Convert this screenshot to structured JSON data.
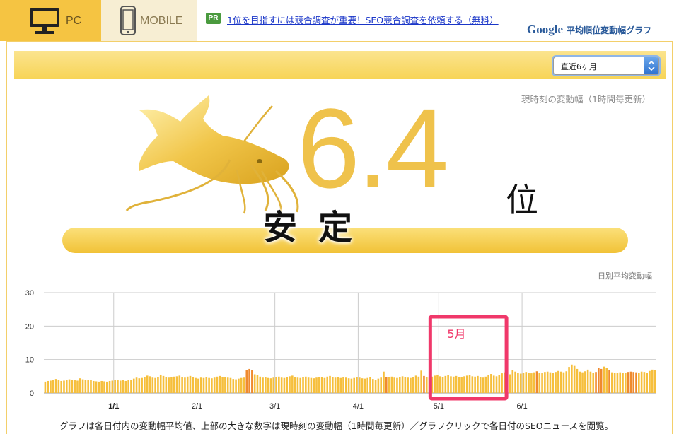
{
  "tabs": [
    {
      "label": "PC",
      "icon": "monitor-icon",
      "active": true
    },
    {
      "label": "MOBILE",
      "icon": "phone-icon",
      "active": false
    }
  ],
  "pr": {
    "badge": "PR",
    "link_text": "1位を目指すには競合調査が重要！SEO競合調査を依頼する（無料）"
  },
  "site_title": {
    "brand": "Google",
    "text": "平均順位変動幅グラフ"
  },
  "range_select": {
    "value": "直近6ヶ月"
  },
  "current": {
    "label": "現時刻の変動幅（1時間毎更新）",
    "value": "6.4",
    "unit": "位",
    "status": "安定"
  },
  "chart_title": "日別平均変動幅",
  "chart_data": {
    "type": "bar",
    "ylim": [
      0,
      30
    ],
    "yticks": [
      0,
      10,
      20,
      30
    ],
    "xticks": [
      "1/1",
      "2/1",
      "3/1",
      "4/1",
      "5/1",
      "6/1"
    ],
    "bold_xtick": "1/1",
    "grid": true,
    "colors": {
      "normal": "#f6bf3c",
      "high": "#ef8a2e"
    },
    "start_date": "12/6",
    "values": [
      3.4,
      3.6,
      3.7,
      3.9,
      4.2,
      3.8,
      3.6,
      3.7,
      3.9,
      4.1,
      3.9,
      3.8,
      3.7,
      4.4,
      4.1,
      4.0,
      3.8,
      3.9,
      3.6,
      3.5,
      3.4,
      3.6,
      3.5,
      3.4,
      3.6,
      3.7,
      3.9,
      3.8,
      3.7,
      3.8,
      3.6,
      3.8,
      3.9,
      4.3,
      4.6,
      4.4,
      4.5,
      4.8,
      5.2,
      5.0,
      4.6,
      4.5,
      4.7,
      5.5,
      5.1,
      4.8,
      4.6,
      4.7,
      4.9,
      5.0,
      5.2,
      4.8,
      4.6,
      4.9,
      5.1,
      4.8,
      4.5,
      4.3,
      4.6,
      4.5,
      4.7,
      4.5,
      4.4,
      4.6,
      4.9,
      5.1,
      4.7,
      4.8,
      4.6,
      4.5,
      4.2,
      4.1,
      4.3,
      4.5,
      4.6,
      6.8,
      7.2,
      6.9,
      5.6,
      5.3,
      4.9,
      4.6,
      4.8,
      4.5,
      4.4,
      4.6,
      4.7,
      4.9,
      4.6,
      4.5,
      4.8,
      5.0,
      5.2,
      4.8,
      4.6,
      4.5,
      4.7,
      4.9,
      4.6,
      4.5,
      4.4,
      4.6,
      4.8,
      4.7,
      4.5,
      4.9,
      5.1,
      4.8,
      4.6,
      4.7,
      4.5,
      4.8,
      4.6,
      4.4,
      4.3,
      4.5,
      4.7,
      4.6,
      4.4,
      4.3,
      4.5,
      4.7,
      4.2,
      4.0,
      4.3,
      4.6,
      6.4,
      4.8,
      4.7,
      4.9,
      4.6,
      4.5,
      4.8,
      5.0,
      4.7,
      4.6,
      4.5,
      4.8,
      5.2,
      4.9,
      6.7,
      5.1,
      4.8,
      4.6,
      4.9,
      5.2,
      5.5,
      5.0,
      4.8,
      5.1,
      5.3,
      5.0,
      4.9,
      5.1,
      4.8,
      4.7,
      5.0,
      5.2,
      5.4,
      5.0,
      4.9,
      5.1,
      4.8,
      4.6,
      4.9,
      5.3,
      5.7,
      5.2,
      5.0,
      5.4,
      5.9,
      6.2,
      6.0,
      5.6,
      6.8,
      6.4,
      6.0,
      5.8,
      6.1,
      6.3,
      6.0,
      5.9,
      6.2,
      6.5,
      6.1,
      6.0,
      6.3,
      6.4,
      6.2,
      6.0,
      6.3,
      6.6,
      6.4,
      6.2,
      6.5,
      7.8,
      8.5,
      8.1,
      7.2,
      6.4,
      6.2,
      6.5,
      7.0,
      6.4,
      6.1,
      6.3,
      7.6,
      7.2,
      7.9,
      7.4,
      6.9,
      6.2,
      6.0,
      6.1,
      6.2,
      6.0,
      6.1,
      6.3,
      6.4,
      6.3,
      6.2,
      6.1,
      6.4,
      6.3,
      6.1,
      6.6,
      7.0,
      6.8
    ],
    "highlight_indices": [
      75,
      76,
      77,
      127,
      141,
      183,
      205,
      206,
      207,
      210,
      217,
      218,
      219,
      220
    ]
  },
  "annotation": {
    "label": "5月",
    "color": "#f0386a"
  },
  "footer_note": "グラフは各日付内の変動幅平均値、上部の大きな数字は現時刻の変動幅（1時間毎更新）／グラフクリックで各日付のSEOニュースを閲覧。"
}
